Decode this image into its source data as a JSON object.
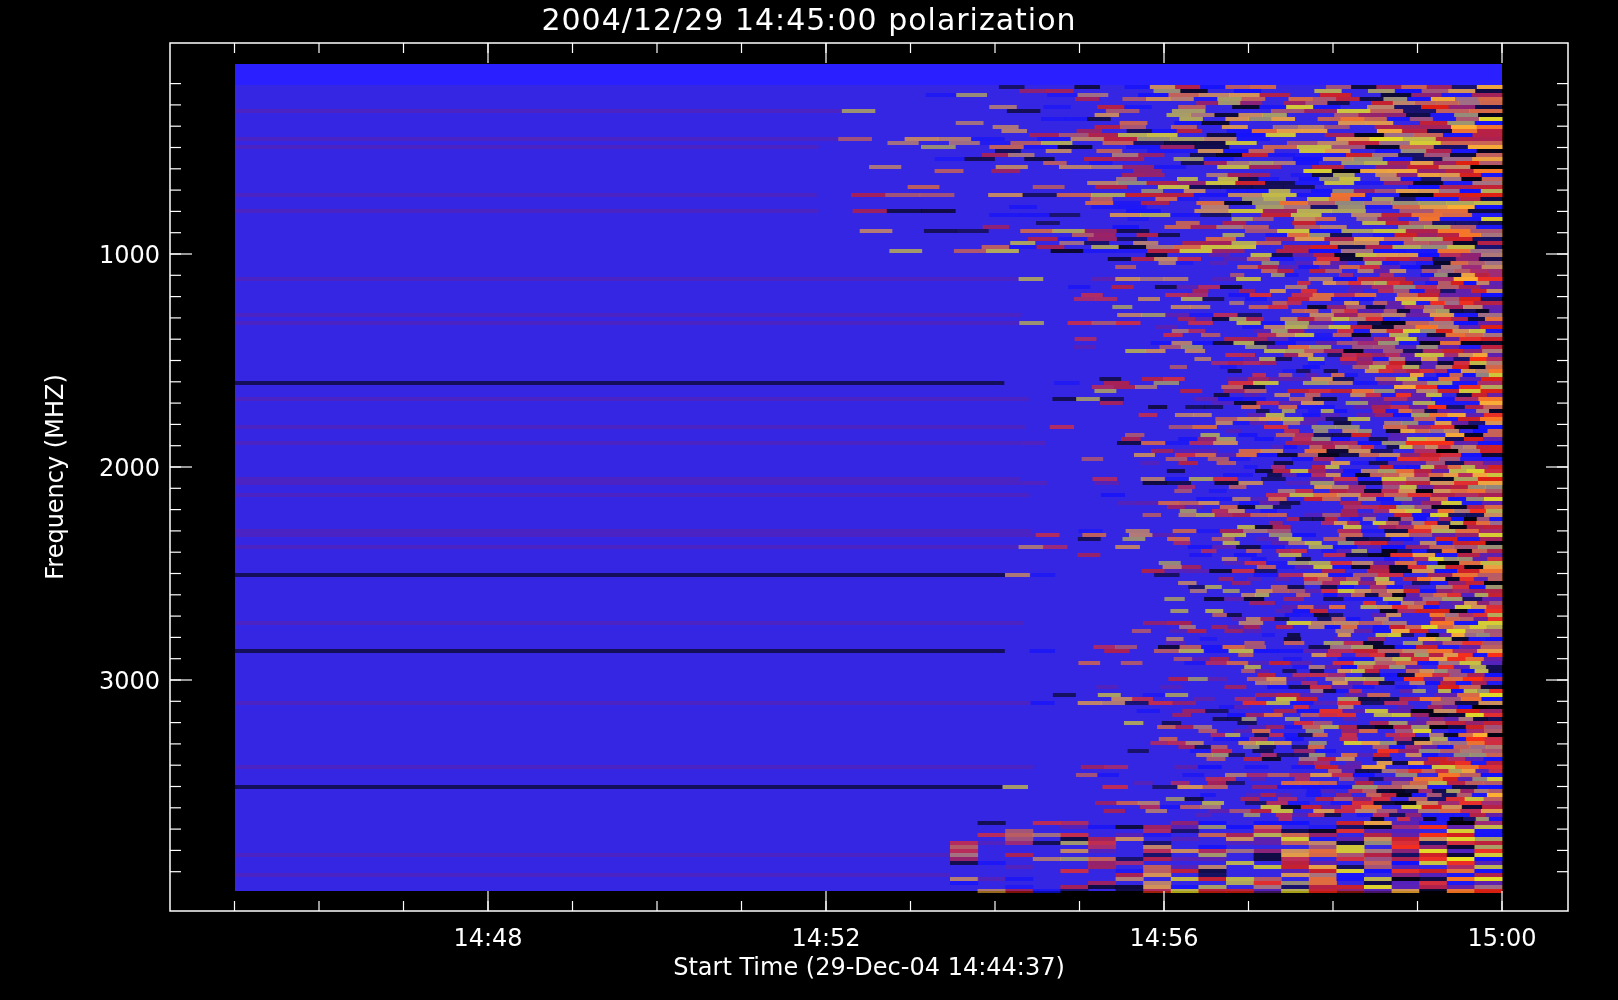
{
  "title": "2004/12/29 14:45:00 polarization",
  "plot": {
    "xlabel": "Start Time (29-Dec-04 14:44:37)",
    "ylabel": "Frequency (MHZ)",
    "xticks": [
      "14:48",
      "14:52",
      "14:56",
      "15:00"
    ],
    "yticks": [
      "1000",
      "2000",
      "3000"
    ]
  }
}
